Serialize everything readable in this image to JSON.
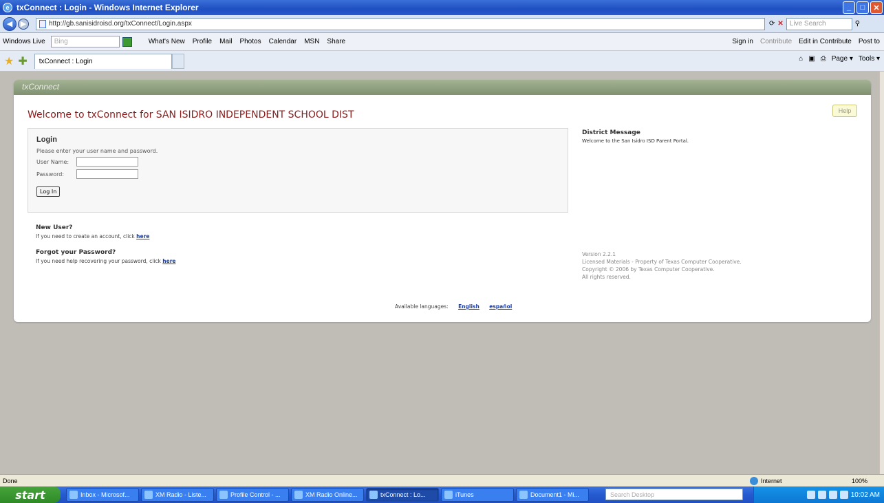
{
  "window": {
    "title": "txConnect : Login - Windows Internet Explorer",
    "minimize": "_",
    "maximize": "□",
    "close": "✕"
  },
  "browser": {
    "url": "http://gb.sanisidroisd.org/txConnect/Login.aspx",
    "search_placeholder": "Live Search",
    "toolbar": {
      "brand": "Windows Live",
      "search_placeholder": "Bing",
      "links": [
        "What's New",
        "Profile",
        "Mail",
        "Photos",
        "Calendar",
        "MSN",
        "Share"
      ],
      "right": [
        "Sign in",
        "Contribute",
        "Edit in Contribute",
        "Post to"
      ]
    },
    "tab_title": "txConnect : Login",
    "commands": [
      "Page ▾",
      "Tools ▾"
    ]
  },
  "page": {
    "header_logo": "txConnect",
    "welcome": "Welcome to txConnect for SAN ISIDRO INDEPENDENT SCHOOL DIST",
    "help_label": "Help",
    "login": {
      "title": "Login",
      "instructions": "Please enter your user name and password.",
      "username_label": "User Name:",
      "password_label": "Password:",
      "button_label": "Log In"
    },
    "new_user": {
      "title": "New User?",
      "text": "If you need to create an account, click ",
      "link": "here"
    },
    "forgot": {
      "title": "Forgot your Password?",
      "text": "If you need help recovering your password, click ",
      "link": "here"
    },
    "district": {
      "title": "District Message",
      "text": "Welcome to the San Isidro ISD Parent Portal."
    },
    "version": {
      "version": "Version 2.2.1",
      "license": "Licensed Materials - Property of Texas Computer Cooperative.",
      "copyright": "Copyright © 2006 by Texas Computer Cooperative.",
      "rights": "All rights reserved."
    },
    "languages": {
      "label": "Available languages:",
      "options": [
        "English",
        "español"
      ]
    }
  },
  "status": {
    "text": "Done",
    "zone": "Internet",
    "zoom": "100%"
  },
  "taskbar": {
    "start": "start",
    "tasks": [
      "Inbox - Microsof...",
      "XM Radio - Liste...",
      "Profile Control - ...",
      "XM Radio Online...",
      "txConnect : Lo...",
      "iTunes",
      "Document1 - Mi..."
    ],
    "search_placeholder": "Search Desktop",
    "time": "10:02 AM"
  }
}
